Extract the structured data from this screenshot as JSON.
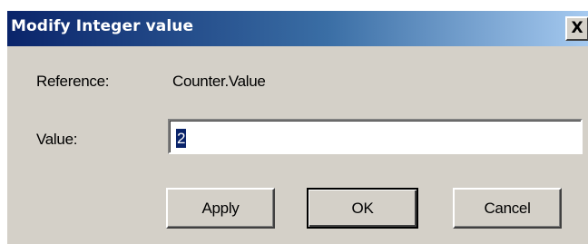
{
  "window": {
    "title": "Modify Integer value",
    "close_glyph": "X"
  },
  "reference": {
    "label": "Reference:",
    "value": "Counter.Value"
  },
  "value_field": {
    "label": "Value:",
    "value": "2"
  },
  "buttons": {
    "apply": "Apply",
    "ok": "OK",
    "cancel": "Cancel"
  },
  "colors": {
    "titlebar_start": "#0a246a",
    "titlebar_end": "#a6caf0",
    "dialog_face": "#d4d0c8",
    "selection": "#0a246a"
  }
}
